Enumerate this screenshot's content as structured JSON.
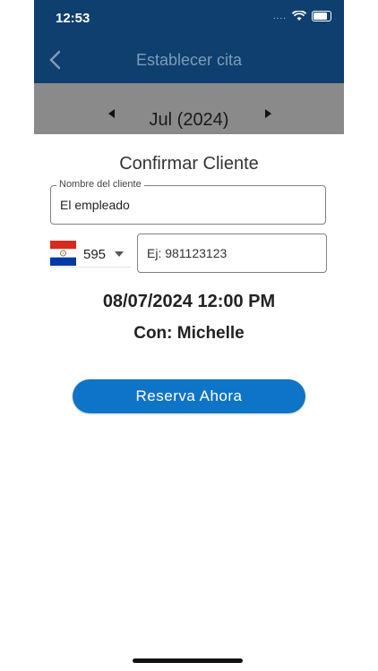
{
  "status_bar": {
    "time": "12:53",
    "signal_dots": "....",
    "wifi_icon": "wifi-icon",
    "battery_icon": "battery-icon"
  },
  "header": {
    "title": "Establecer cita",
    "back_icon": "chevron-left-icon",
    "background": "#0e3f6e"
  },
  "calendar": {
    "month_label": "Jul (2024)",
    "prev_icon": "triangle-left-icon",
    "next_icon": "triangle-right-icon"
  },
  "sheet": {
    "title": "Confirmar Cliente",
    "name_field": {
      "label": "Nombre del cliente",
      "value": "El empleado"
    },
    "country": {
      "flag_icon": "paraguay-flag-icon",
      "code": "595"
    },
    "phone_field": {
      "placeholder": "Ej: 981123123"
    },
    "datetime": "08/07/2024 12:00 PM",
    "with": "Con: Michelle",
    "reserve_label": "Reserva Ahora"
  },
  "colors": {
    "accent": "#0e74c7",
    "header": "#0e3f6e",
    "overlay": "#8a8a8a"
  }
}
